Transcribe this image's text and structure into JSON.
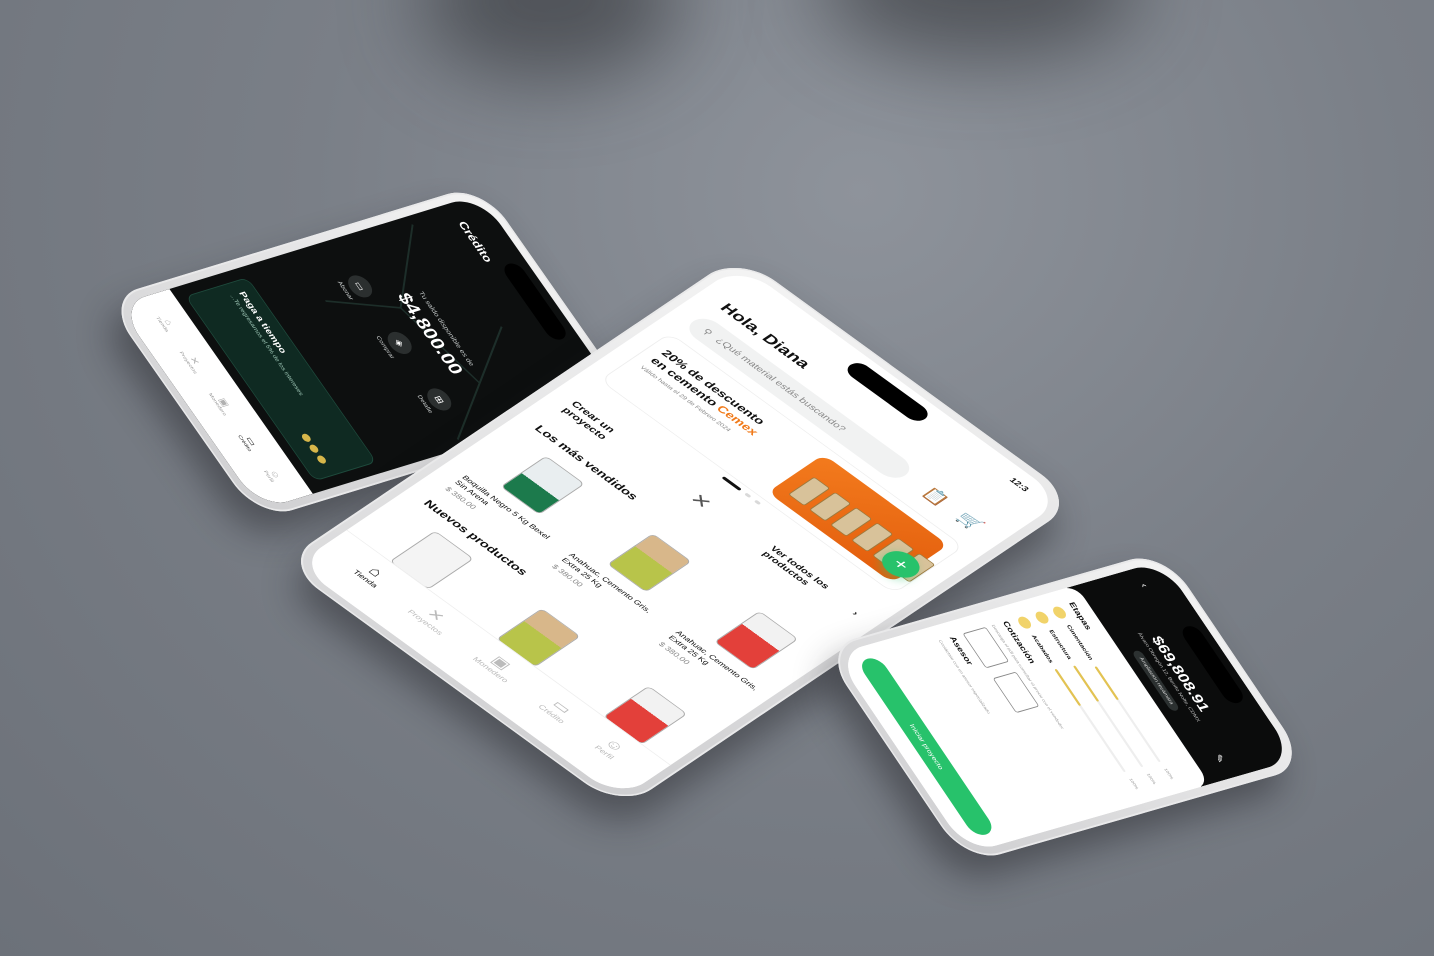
{
  "credit_screen": {
    "title": "Crédito",
    "saldo_label": "Tu saldo disponible es de",
    "saldo": "$4,800.00",
    "actions": [
      {
        "label": "Abonar",
        "icon": "card-icon"
      },
      {
        "label": "Comprar",
        "icon": "bag-icon"
      },
      {
        "label": "Detalle",
        "icon": "detail-icon"
      }
    ],
    "banner": {
      "title": "Paga a tiempo",
      "text": "...Te regresamos el 5% de los intereses"
    },
    "tabs": [
      {
        "label": "Tienda",
        "icon": "store-icon"
      },
      {
        "label": "Proyectos",
        "icon": "tools-icon"
      },
      {
        "label": "Monedero",
        "icon": "wallet-icon"
      },
      {
        "label": "Crédito",
        "icon": "credit-icon",
        "active": true
      },
      {
        "label": "Perfil",
        "icon": "user-icon"
      }
    ]
  },
  "store_screen": {
    "status_time": "12:3",
    "greeting": "Hola, Diana",
    "search_placeholder": "¿Qué material estás buscando?",
    "promo": {
      "title_line1": "20% de descuento",
      "title_line2": "en cemento",
      "brand": "Cemex",
      "note": "Válido hasta el 29 de Febrero 2024"
    },
    "create_project": "Crear un proyecto",
    "see_all": "Ver todos los productos",
    "best_sellers_title": "Los más vendidos",
    "best_sellers": [
      {
        "name": "Boquilla Negro 5 Kg Bexel Sin Arena",
        "price": "$ 380.00"
      },
      {
        "name": "Anahuac, Cemento Gris, Extra 25 Kg",
        "price": "$ 380.00"
      },
      {
        "name": "Anahuac, Cemento Gris, Extra 25 Kg",
        "price": "$ 380.00"
      }
    ],
    "new_products_title": "Nuevos productos",
    "tabs": [
      {
        "label": "Tienda",
        "icon": "store-icon",
        "active": true
      },
      {
        "label": "Proyectos",
        "icon": "tools-icon"
      },
      {
        "label": "Monedero",
        "icon": "wallet-icon"
      },
      {
        "label": "Crédito",
        "icon": "credit-icon"
      },
      {
        "label": "Perfil",
        "icon": "user-icon"
      }
    ]
  },
  "project_screen": {
    "amount": "$69,808.91",
    "address": "Álvaro Obregón 12, Benito Nolte, CDMX",
    "pill": "Ampliación recámara",
    "stages_title": "Etapas",
    "stages": [
      {
        "name": "Cimentación",
        "progress": 0.35,
        "pct": "100%"
      },
      {
        "name": "Estructura",
        "progress": 0.35,
        "pct": "100%"
      },
      {
        "name": "Acabados",
        "progress": 0.35,
        "pct": "100%"
      }
    ],
    "quote_title": "Cotización",
    "quote_text": "Descarga el pdf para consultar el precio con el vendedor",
    "advisor_title": "Asesor",
    "advisor_text": "Contáctate con un asesor especializado",
    "cta": "Iniciar proyecto"
  }
}
